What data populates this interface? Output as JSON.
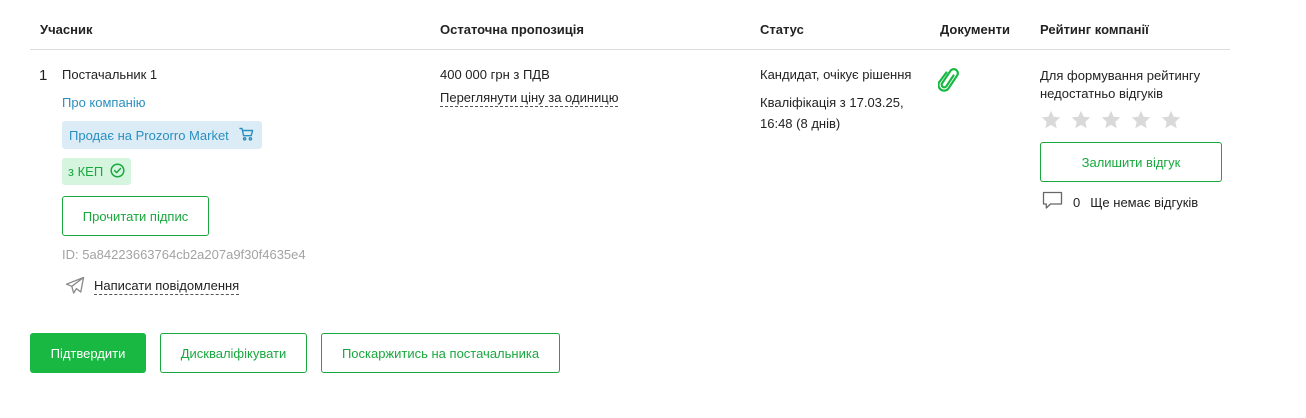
{
  "header": {
    "participant": "Учасник",
    "final_offer": "Остаточна пропозиція",
    "status": "Статус",
    "documents": "Документи",
    "rating": "Рейтинг компанії"
  },
  "row": {
    "number": "1",
    "supplier_name": "Постачальник 1",
    "about_link": "Про компанію",
    "market_badge": "Продає на Prozorro Market",
    "kep_badge": "з КЕП",
    "read_signature": "Прочитати підпис",
    "id_text": "ID: 5a84223663764cb2a207a9f30f4635e4",
    "write_message": "Написати повідомлення",
    "price": "400 000 грн з ПДВ",
    "unit_price_link": "Переглянути ціну за одиницю",
    "status": "Кандидат, очікує рішення",
    "qualification_line1": "Кваліфікація з 17.03.25,",
    "qualification_line2": "16:48 (8 днів)",
    "rating_msg_line1": "Для формування рейтингу",
    "rating_msg_line2": "недостатньо відгуків",
    "stars_filled": 0,
    "stars_total": 5,
    "leave_review": "Залишити відгук",
    "reviews_count": "0",
    "reviews_text": "Ще немає відгуків"
  },
  "actions": {
    "confirm": "Підтвердити",
    "disqualify": "Дискваліфікувати",
    "complain": "Поскаржитись на постачальника"
  },
  "colors": {
    "green": "#19b843",
    "green_text": "#19a83e",
    "blue_link": "#2a8fc0",
    "market_bg": "#dcecf7",
    "kep_bg": "#d5f5de",
    "star_empty": "#d9d9d9",
    "muted": "#a3a3a3"
  },
  "icons": {
    "cart": "cart-icon",
    "check": "check-circle-icon",
    "send": "paper-plane-icon",
    "document": "paperclip-icon",
    "star": "star-icon",
    "comment": "comment-icon"
  }
}
